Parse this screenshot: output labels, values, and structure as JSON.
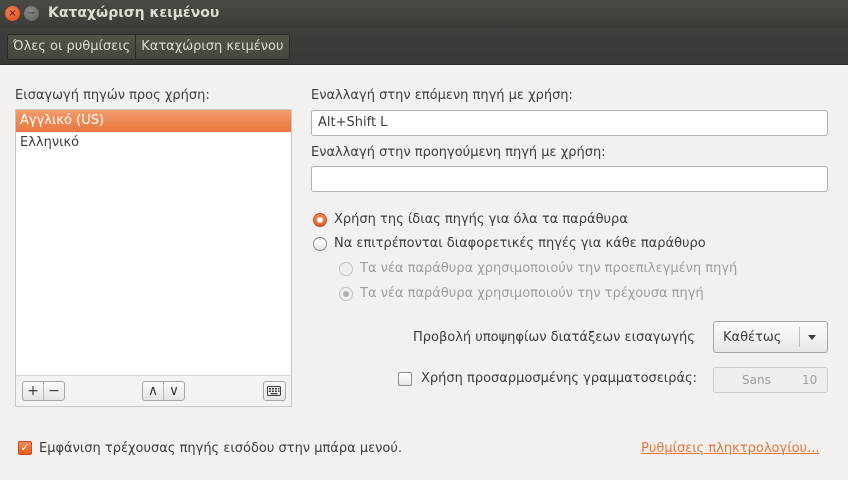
{
  "window": {
    "title": "Καταχώριση κειμένου",
    "close_glyph": "×",
    "minimize_glyph": "−"
  },
  "breadcrumb": {
    "all_settings": "Όλες οι ρυθμίσεις",
    "current": "Καταχώριση κειμένου"
  },
  "sources": {
    "label": "Εισαγωγή πηγών προς χρήση:",
    "items": [
      {
        "label": "Αγγλικό (US)",
        "selected": true
      },
      {
        "label": "Ελληνικό",
        "selected": false
      }
    ],
    "toolbar": {
      "add_icon": "+",
      "remove_icon": "−",
      "up_icon": "∧",
      "down_icon": "∨",
      "keyboard_icon": "keyboard-icon"
    }
  },
  "shortcuts": {
    "next_label": "Εναλλαγή στην επόμενη πηγή με χρήση:",
    "next_value": "Alt+Shift L",
    "prev_label": "Εναλλαγή στην προηγούμενη πηγή με χρήση:",
    "prev_value": ""
  },
  "source_mode": {
    "same_label": "Χρήση της ίδιας πηγής για όλα τα παράθυρα",
    "per_window_label": "Να επιτρέπονται διαφορετικές πηγές για κάθε παράθυρο",
    "new_default_label": "Τα νέα παράθυρα χρησιμοποιούν την προεπιλεγμένη πηγή",
    "new_current_label": "Τα νέα παράθυρα χρησιμοποιούν την τρέχουσα πηγή",
    "selected": "same"
  },
  "candidates": {
    "label": "Προβολή υποψηφίων διατάξεων εισαγωγής",
    "value": "Καθέτως"
  },
  "custom_font": {
    "label": "Χρήση προσαρμοσμένης γραμματοσειράς:",
    "checked": false,
    "font_name": "Sans",
    "font_size": "10"
  },
  "footer": {
    "show_indicator_label": "Εμφάνιση τρέχουσας πηγής εισόδου στην μπάρα μενού.",
    "show_indicator_checked": true,
    "keyboard_settings_link": "Ρυθμίσεις πληκτρολογίου..."
  },
  "colors": {
    "accent": "#e9773f",
    "titlebar": "#3c3b37",
    "background": "#f2f1f0"
  }
}
